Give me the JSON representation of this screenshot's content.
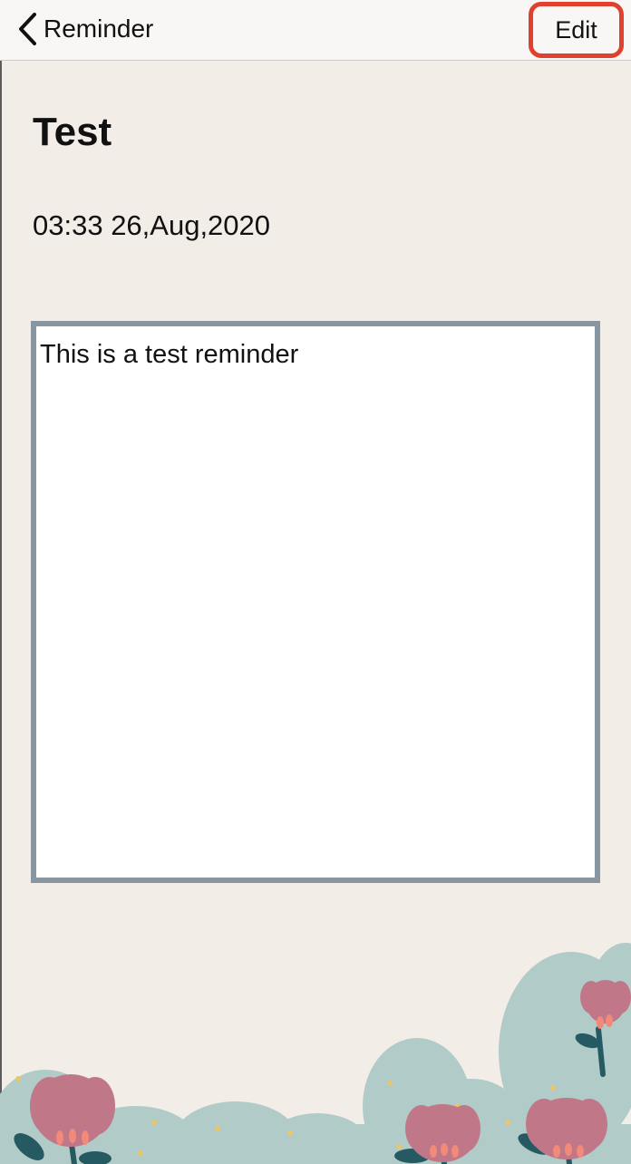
{
  "nav": {
    "back_label": "Reminder",
    "edit_label": "Edit"
  },
  "reminder": {
    "title": "Test",
    "datetime": "03:33 26,Aug,2020",
    "body": "This is a test reminder"
  },
  "icons": {
    "back": "chevron-left-icon",
    "decoration": "floral-decoration"
  },
  "colors": {
    "background": "#f2ede7",
    "edit_highlight": "#e0402e",
    "note_border": "#8896a2",
    "flower_pink": "#c07888",
    "leaf_green": "#b0cbc8"
  }
}
